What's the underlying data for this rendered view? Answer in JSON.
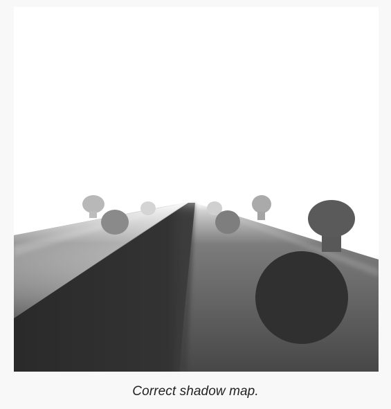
{
  "figure": {
    "image_description_icon": "depth-map-render",
    "caption": "Correct shadow map.",
    "colors": {
      "page_background": "#f8f8f8",
      "image_background": "#ffffff",
      "caption_text": "#222222"
    }
  }
}
